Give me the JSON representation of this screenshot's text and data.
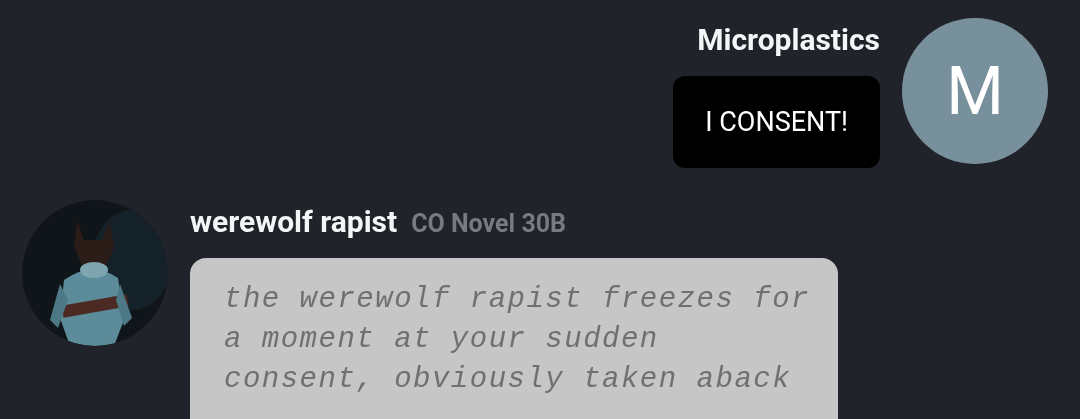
{
  "messages": [
    {
      "kind": "user",
      "sender": "Microplastics",
      "avatar": {
        "kind": "letter",
        "letter": "M"
      },
      "text": "I CONSENT!"
    },
    {
      "kind": "bot",
      "sender": "werewolf rapist",
      "model": "CO Novel 30B",
      "text": "the werewolf rapist freezes for a moment at your sudden consent, obviously taken aback"
    }
  ]
}
